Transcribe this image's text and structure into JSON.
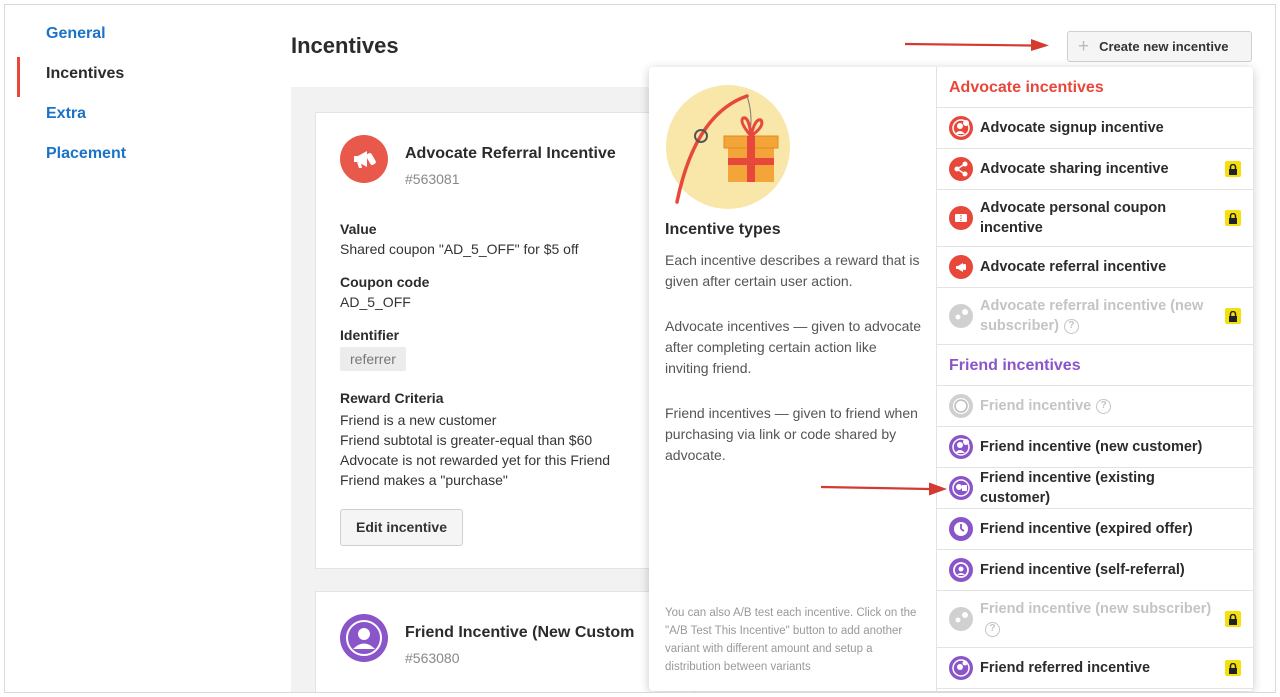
{
  "sidebar": {
    "items": [
      {
        "label": "General",
        "active": false
      },
      {
        "label": "Incentives",
        "active": true
      },
      {
        "label": "Extra",
        "active": false
      },
      {
        "label": "Placement",
        "active": false
      }
    ]
  },
  "page": {
    "title": "Incentives",
    "create_button_label": "Create new incentive"
  },
  "cards": [
    {
      "title": "Advocate Referral Incentive",
      "id": "#563081",
      "icon": "megaphone-icon",
      "value_label": "Value",
      "value": "Shared coupon \"AD_5_OFF\" for $5 off",
      "coupon_label": "Coupon code",
      "coupon": "AD_5_OFF",
      "identifier_label": "Identifier",
      "identifier": "referrer",
      "criteria_label": "Reward Criteria",
      "criteria": [
        "Friend is a new customer",
        "Friend subtotal is greater-equal than $60",
        "Advocate is not rewarded yet for this Friend",
        "Friend makes a \"purchase\""
      ],
      "edit_label": "Edit incentive"
    },
    {
      "title": "Friend Incentive (New Custom",
      "id": "#563080",
      "icon": "friend-user-icon"
    }
  ],
  "popover": {
    "heading": "Incentive types",
    "paragraphs": [
      "Each incentive describes a reward that is given after certain user action.",
      "Advocate incentives — given to advocate after completing certain action like inviting friend.",
      "Friend incentives — given to friend when purchasing via link or code shared by advocate."
    ],
    "note": "You can also A/B test each incentive. Click on the \"A/B Test This Incentive\" button to add another variant with different amount and setup a distribution between variants",
    "advocate_heading": "Advocate incentives",
    "friend_heading": "Friend incentives",
    "advocate_items": [
      {
        "label": "Advocate signup incentive",
        "locked": false,
        "disabled": false,
        "help": false
      },
      {
        "label": "Advocate sharing incentive",
        "locked": true,
        "disabled": false,
        "help": false
      },
      {
        "label": "Advocate personal coupon incentive",
        "locked": true,
        "disabled": false,
        "help": false
      },
      {
        "label": "Advocate referral incentive",
        "locked": false,
        "disabled": false,
        "help": false
      },
      {
        "label": "Advocate referral incentive (new subscriber)",
        "locked": true,
        "disabled": true,
        "help": true
      }
    ],
    "friend_items": [
      {
        "label": "Friend incentive",
        "locked": false,
        "disabled": true,
        "help": true
      },
      {
        "label": "Friend incentive (new customer)",
        "locked": false,
        "disabled": false,
        "help": false
      },
      {
        "label": "Friend incentive (existing customer)",
        "locked": false,
        "disabled": false,
        "help": false
      },
      {
        "label": "Friend incentive (expired offer)",
        "locked": false,
        "disabled": false,
        "help": false
      },
      {
        "label": "Friend incentive (self-referral)",
        "locked": false,
        "disabled": false,
        "help": false
      },
      {
        "label": "Friend incentive (new subscriber)",
        "locked": true,
        "disabled": true,
        "help": true
      },
      {
        "label": "Friend referred incentive",
        "locked": true,
        "disabled": false,
        "help": false
      }
    ]
  },
  "colors": {
    "link": "#1a73c9",
    "advocate": "#e8473b",
    "friend": "#8a55c9",
    "lock": "#f5df0c",
    "arrow": "#d43a2f"
  }
}
